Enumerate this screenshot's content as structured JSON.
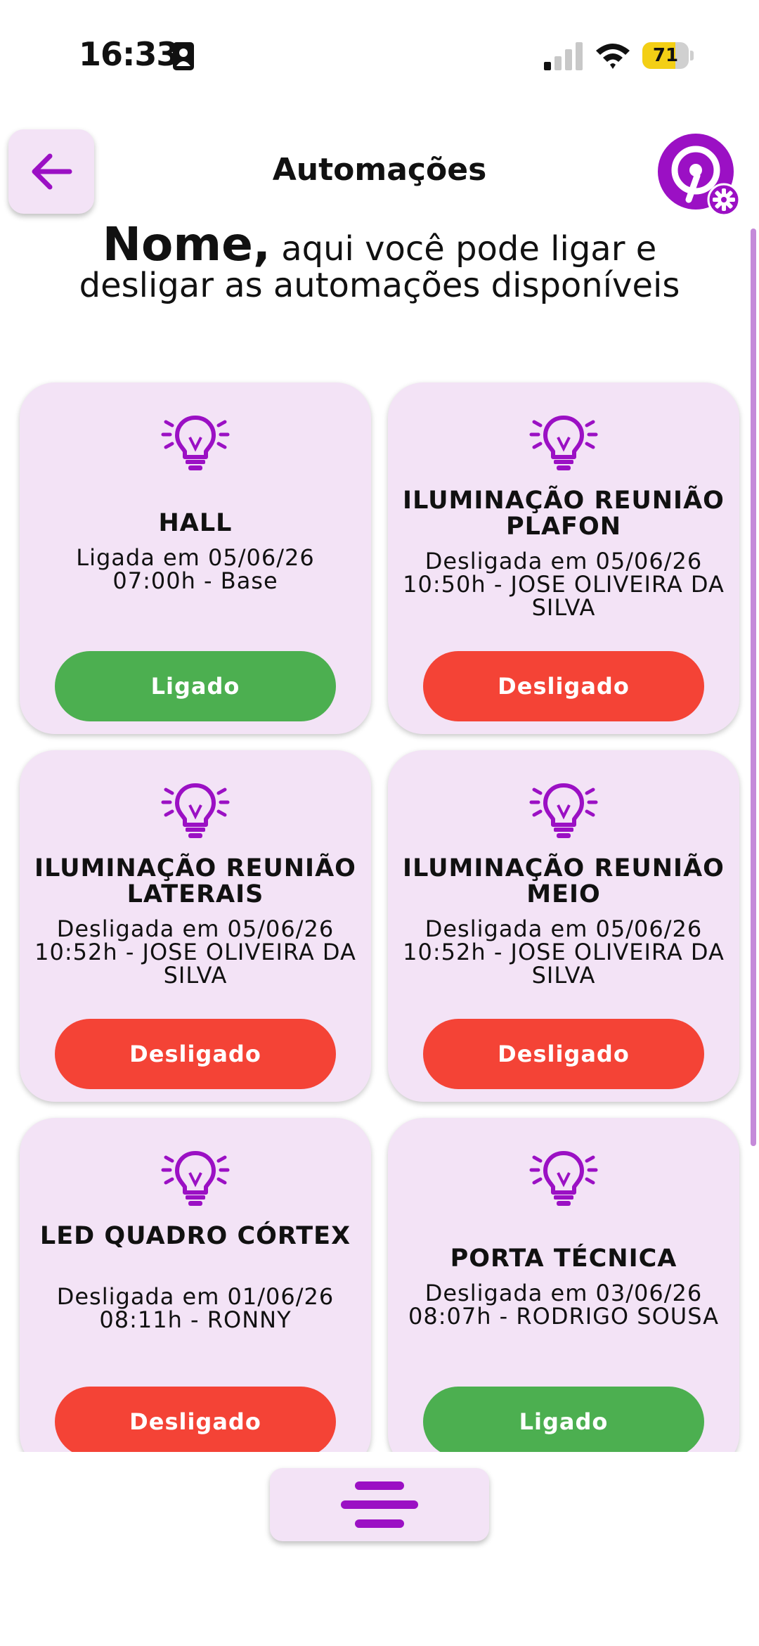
{
  "status_bar": {
    "time": "16:33",
    "battery": "71",
    "battery_level": 0.71
  },
  "header": {
    "title": "Automações"
  },
  "intro": {
    "name": "Nome,",
    "text": " aqui você pode  ligar e desligar as automações disponíveis"
  },
  "colors": {
    "accent": "#9b10c4",
    "card_bg": "#f3e3f6",
    "on": "#4caf50",
    "off": "#f44336"
  },
  "automations": [
    {
      "name": "HALL",
      "info": "Ligada em 05/06/26 07:00h - Base",
      "toggle": "Ligado",
      "state": "on"
    },
    {
      "name": "ILUMINAÇÃO REUNIÃO PLAFON",
      "info": "Desligada em 05/06/26 10:50h - JOSE OLIVEIRA DA SILVA",
      "toggle": "Desligado",
      "state": "off"
    },
    {
      "name": "ILUMINAÇÃO REUNIÃO LATERAIS",
      "info": "Desligada em 05/06/26 10:52h - JOSE OLIVEIRA DA SILVA",
      "toggle": "Desligado",
      "state": "off"
    },
    {
      "name": "ILUMINAÇÃO REUNIÃO MEIO",
      "info": "Desligada em 05/06/26 10:52h - JOSE OLIVEIRA DA SILVA",
      "toggle": "Desligado",
      "state": "off"
    },
    {
      "name": "LED QUADRO CÓRTEX",
      "info": "Desligada em 01/06/26 08:11h - RONNY",
      "toggle": "Desligado",
      "state": "off"
    },
    {
      "name": "PORTA TÉCNICA",
      "info": "Desligada em 03/06/26 08:07h - RODRIGO SOUSA",
      "toggle": "Ligado",
      "state": "on"
    }
  ],
  "icons": {
    "back": "arrow-left-icon",
    "logo": "app-logo-settings-icon",
    "bulb": "lightbulb-icon",
    "menu": "menu-icon"
  }
}
